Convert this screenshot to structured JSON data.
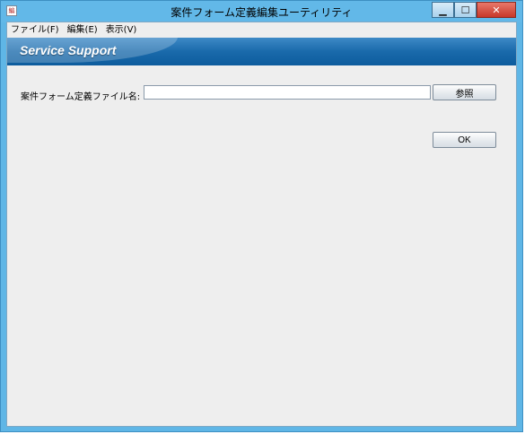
{
  "window": {
    "title": "案件フォーム定義編集ユーティリティ",
    "app_icon_glyph": "編",
    "controls": {
      "minimize": "▁",
      "maximize": "☐",
      "close": "✕"
    }
  },
  "menu": {
    "items": [
      {
        "label": "ファイル(F)"
      },
      {
        "label": "編集(E)"
      },
      {
        "label": "表示(V)"
      }
    ]
  },
  "banner": {
    "title": "Service Support"
  },
  "form": {
    "label": "案件フォーム定義ファイル名:",
    "value": "",
    "browse_label": "参照",
    "ok_label": "OK"
  },
  "colors": {
    "titlebar": "#62b8e8",
    "banner": "#1a6aab",
    "background": "#eeeeee",
    "close_button": "#c7382a"
  }
}
